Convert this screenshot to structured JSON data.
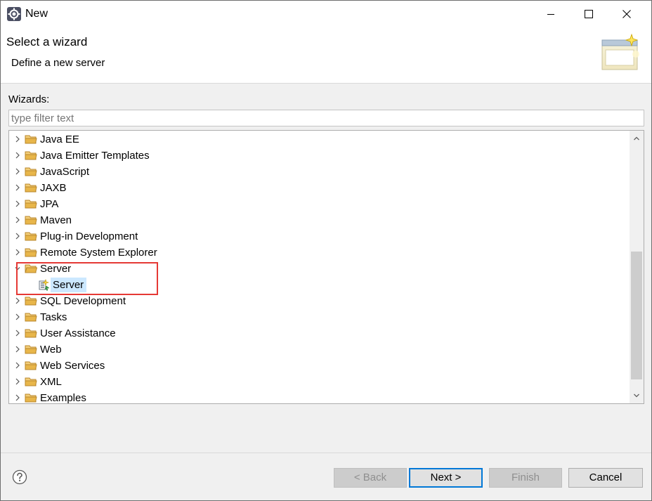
{
  "window": {
    "title": "New",
    "icon": "eclipse-gear-icon"
  },
  "banner": {
    "title": "Select a wizard",
    "description": "Define a new server",
    "image": "wizard-window-sparkle-icon"
  },
  "filter": {
    "label": "Wizards:",
    "placeholder": "type filter text",
    "value": ""
  },
  "tree": {
    "items": [
      {
        "label": "Java EE",
        "expanded": false
      },
      {
        "label": "Java Emitter Templates",
        "expanded": false
      },
      {
        "label": "JavaScript",
        "expanded": false
      },
      {
        "label": "JAXB",
        "expanded": false
      },
      {
        "label": "JPA",
        "expanded": false
      },
      {
        "label": "Maven",
        "expanded": false
      },
      {
        "label": "Plug-in Development",
        "expanded": false
      },
      {
        "label": "Remote System Explorer",
        "expanded": false
      },
      {
        "label": "Server",
        "expanded": true,
        "children": [
          {
            "label": "Server",
            "selected": true
          }
        ]
      },
      {
        "label": "SQL Development",
        "expanded": false
      },
      {
        "label": "Tasks",
        "expanded": false
      },
      {
        "label": "User Assistance",
        "expanded": false
      },
      {
        "label": "Web",
        "expanded": false
      },
      {
        "label": "Web Services",
        "expanded": false
      },
      {
        "label": "XML",
        "expanded": false
      },
      {
        "label": "Examples",
        "expanded": false
      }
    ],
    "highlight_color": "#e53935",
    "selection_color": "#cce8ff"
  },
  "buttons": {
    "back": "< Back",
    "next": "Next >",
    "finish": "Finish",
    "cancel": "Cancel"
  },
  "colors": {
    "accent": "#0078d7",
    "folder": "#e8b64a"
  }
}
